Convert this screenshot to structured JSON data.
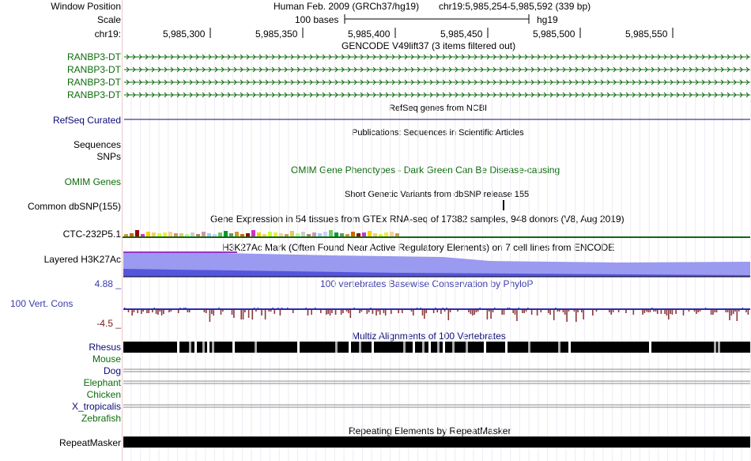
{
  "header": {
    "window_position_label": "Window Position",
    "scale_label": "Scale",
    "chrom_label": "chr19:",
    "assembly": "Human Feb. 2009 (GRCh37/hg19)",
    "position": "chr19:5,985,254-5,985,592 (339 bp)",
    "scale_text": "100 bases",
    "scale_db": "hg19",
    "ruler_ticks": [
      "5,985,300",
      "5,985,350",
      "5,985,400",
      "5,985,450",
      "5,985,500",
      "5,985,550"
    ]
  },
  "tracks": {
    "gencode": {
      "title": "GENCODE V49lift37 (3 items filtered out)",
      "items": [
        "RANBP3-DT",
        "RANBP3-DT",
        "RANBP3-DT",
        "RANBP3-DT"
      ],
      "color": "#0c6b0c"
    },
    "refseq": {
      "title": "RefSeq genes from NCBI",
      "label": "RefSeq Curated",
      "color": "#0c0c78"
    },
    "publications": {
      "title": "Publications: Sequences in Scientific Articles",
      "labels": [
        "Sequences",
        "SNPs"
      ]
    },
    "omim": {
      "title": "OMIM Gene Phenotypes - Dark Green Can Be Disease-causing",
      "label": "OMIM Genes",
      "color": "#0c6b0c"
    },
    "dbsnp": {
      "title": "Short Genetic Variants from dbSNP release 155",
      "label": "Common dbSNP(155)"
    },
    "gtex": {
      "title": "Gene Expression in 54 tissues from GTEx RNA-seq of 17382 samples, 948 donors (V8, Aug 2019)",
      "label": "CTC-232P5.1"
    },
    "h3k27ac": {
      "title": "H3K27Ac Mark (Often Found Near Active Regulatory Elements) on 7 cell lines from ENCODE",
      "label": "Layered H3K27Ac"
    },
    "phylop": {
      "title": "100 vertebrates Basewise Conservation by PhyloP",
      "label": "100 Vert. Cons",
      "max_label": "4.88 _",
      "min_label": "-4.5 _"
    },
    "multiz": {
      "title": "Multiz Alignments of 100 Vertebrates",
      "species": [
        "Rhesus",
        "Mouse",
        "Dog",
        "Elephant",
        "Chicken",
        "X_tropicalis",
        "Zebrafish"
      ]
    },
    "repeatmasker": {
      "title": "Repeating Elements by RepeatMasker",
      "label": "RepeatMasker"
    }
  }
}
